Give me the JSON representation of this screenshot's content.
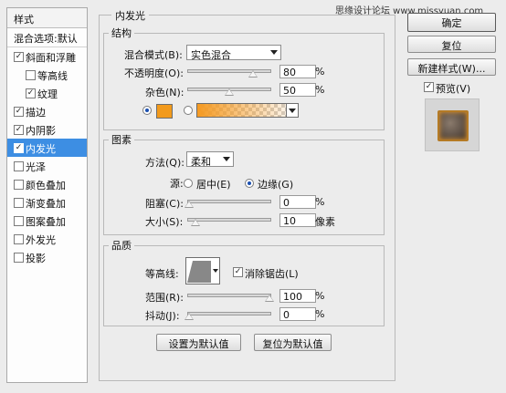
{
  "sidebar": {
    "header": "样式",
    "blend_default": "混合选项:默认",
    "items": [
      {
        "label": "斜面和浮雕",
        "checked": true
      },
      {
        "label": "等高线",
        "checked": false
      },
      {
        "label": "纹理",
        "checked": true
      },
      {
        "label": "描边",
        "checked": true
      },
      {
        "label": "内阴影",
        "checked": true
      },
      {
        "label": "内发光",
        "checked": true
      },
      {
        "label": "光泽",
        "checked": false
      },
      {
        "label": "颜色叠加",
        "checked": false
      },
      {
        "label": "渐变叠加",
        "checked": false
      },
      {
        "label": "图案叠加",
        "checked": false
      },
      {
        "label": "外发光",
        "checked": false
      },
      {
        "label": "投影",
        "checked": false
      }
    ],
    "check_mark": "✓"
  },
  "panel": {
    "title": "内发光",
    "structure": {
      "title": "结构",
      "blend_mode_label": "混合模式(B):",
      "blend_mode_value": "实色混合",
      "opacity_label": "不透明度(O):",
      "opacity_value": "80",
      "noise_label": "杂色(N):",
      "noise_value": "50",
      "percent": "%",
      "swatch_color": "#f29a1c"
    },
    "elements": {
      "title": "图素",
      "technique_label": "方法(Q):",
      "technique_value": "柔和",
      "source_label": "源:",
      "center_label": "居中(E)",
      "edge_label": "边缘(G)",
      "choke_label": "阻塞(C):",
      "choke_value": "0",
      "size_label": "大小(S):",
      "size_value": "10",
      "size_unit": "像素"
    },
    "quality": {
      "title": "品质",
      "contour_label": "等高线:",
      "antialias_label": "消除锯齿(L)",
      "range_label": "范围(R):",
      "range_value": "100",
      "jitter_label": "抖动(J):",
      "jitter_value": "0"
    },
    "set_default": "设置为默认值",
    "reset_default": "复位为默认值"
  },
  "right": {
    "ok": "确定",
    "reset": "复位",
    "new_style": "新建样式(W)...",
    "preview_label": "预览(V)"
  },
  "watermark": "思缘设计论坛  www.missyuan.com"
}
